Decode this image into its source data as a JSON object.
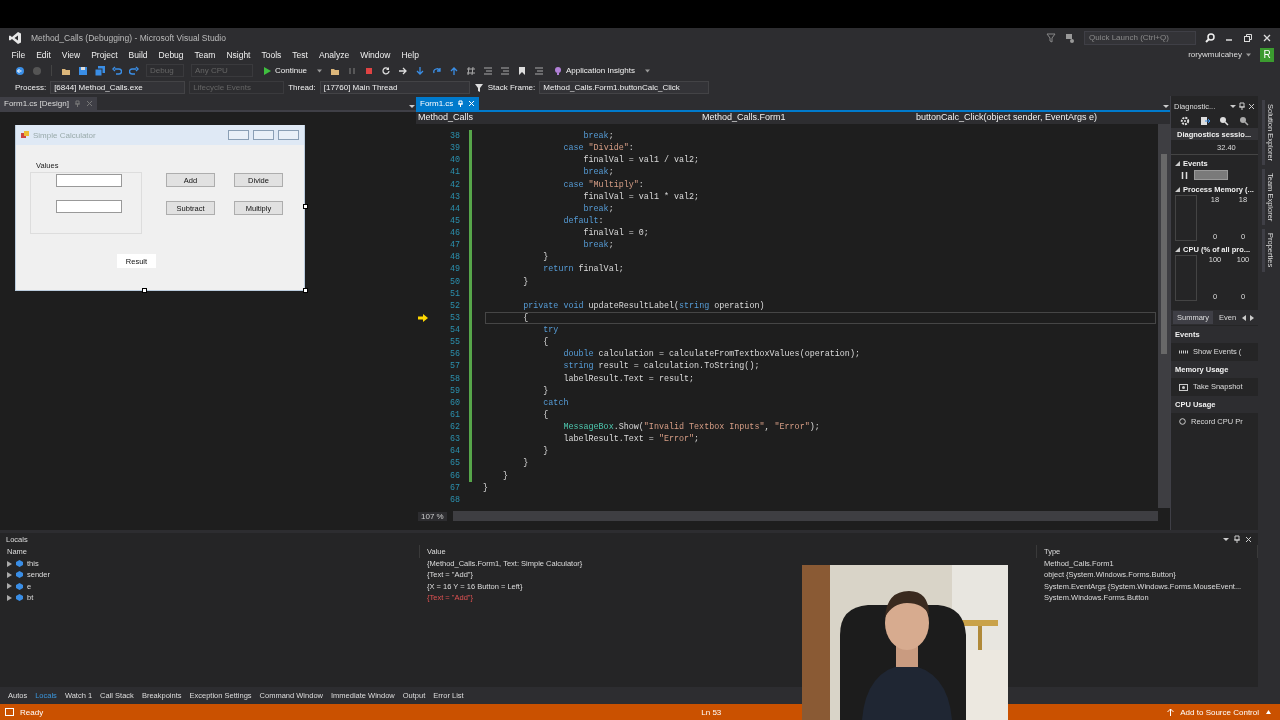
{
  "window": {
    "title": "Method_Calls (Debugging) - Microsoft Visual Studio"
  },
  "title_bar": {
    "quick_launch": {
      "placeholder": "Quick Launch (Ctrl+Q)"
    },
    "user": "rorywmulcahey",
    "avatar": "R"
  },
  "menu": [
    "File",
    "Edit",
    "View",
    "Project",
    "Build",
    "Debug",
    "Team",
    "Nsight",
    "Tools",
    "Test",
    "Analyze",
    "Window",
    "Help"
  ],
  "toolbar": {
    "configuration": {
      "text": "Debug",
      "disabled": true
    },
    "platform": {
      "text": "Any CPU",
      "disabled": true
    },
    "continue": "Continue",
    "application_insights": "Application Insights"
  },
  "debug_location": {
    "process_label": "Process:",
    "process": "[6844] Method_Calls.exe",
    "lifecycle": {
      "text": "Lifecycle Events",
      "disabled": true
    },
    "thread_label": "Thread:",
    "thread": "[17760] Main Thread",
    "stack_frame_label": "Stack Frame:",
    "stack_frame": "Method_Calls.Form1.buttonCalc_Click"
  },
  "designer": {
    "tab": "Form1.cs [Design]",
    "form": {
      "title": "Simple Calculator",
      "group_label": "Values",
      "buttons": [
        "Add",
        "Divide",
        "Subtract",
        "Multiply"
      ],
      "result": "Result"
    }
  },
  "editor": {
    "tab": "Form1.cs",
    "project": "Method_Calls",
    "class": "Method_Calls.Form1",
    "member": "buttonCalc_Click(object sender, EventArgs e)",
    "zoom": "107 %",
    "lines": [
      {
        "number": "38",
        "current": false,
        "tokens": [
          {
            "kind": "keyword",
            "text": "                    break"
          },
          {
            "kind": "plain",
            "text": ";"
          }
        ]
      },
      {
        "number": "39",
        "current": false,
        "tokens": [
          {
            "kind": "keyword",
            "text": "                case"
          },
          {
            "kind": "string",
            "text": " \"Divide\""
          },
          {
            "kind": "plain",
            "text": ":"
          }
        ]
      },
      {
        "number": "40",
        "current": false,
        "tokens": [
          {
            "kind": "plain",
            "text": "                    finalVal = val1 / val2;"
          }
        ]
      },
      {
        "number": "41",
        "current": false,
        "tokens": [
          {
            "kind": "keyword",
            "text": "                    break"
          },
          {
            "kind": "plain",
            "text": ";"
          }
        ]
      },
      {
        "number": "42",
        "current": false,
        "tokens": [
          {
            "kind": "keyword",
            "text": "                case"
          },
          {
            "kind": "string",
            "text": " \"Multiply\""
          },
          {
            "kind": "plain",
            "text": ":"
          }
        ]
      },
      {
        "number": "43",
        "current": false,
        "tokens": [
          {
            "kind": "plain",
            "text": "                    finalVal = val1 * val2;"
          }
        ]
      },
      {
        "number": "44",
        "current": false,
        "tokens": [
          {
            "kind": "keyword",
            "text": "                    break"
          },
          {
            "kind": "plain",
            "text": ";"
          }
        ]
      },
      {
        "number": "45",
        "current": false,
        "tokens": [
          {
            "kind": "keyword",
            "text": "                default"
          },
          {
            "kind": "plain",
            "text": ":"
          }
        ]
      },
      {
        "number": "46",
        "current": false,
        "tokens": [
          {
            "kind": "plain",
            "text": "                    finalVal = 0;"
          }
        ]
      },
      {
        "number": "47",
        "current": false,
        "tokens": [
          {
            "kind": "keyword",
            "text": "                    break"
          },
          {
            "kind": "plain",
            "text": ";"
          }
        ]
      },
      {
        "number": "48",
        "current": false,
        "tokens": [
          {
            "kind": "plain",
            "text": "            }"
          }
        ]
      },
      {
        "number": "49",
        "current": false,
        "tokens": [
          {
            "kind": "keyword",
            "text": "            return"
          },
          {
            "kind": "plain",
            "text": " finalVal;"
          }
        ]
      },
      {
        "number": "50",
        "current": false,
        "tokens": [
          {
            "kind": "plain",
            "text": "        }"
          }
        ]
      },
      {
        "number": "51",
        "current": false
      },
      {
        "number": "52",
        "current": false,
        "tokens": [
          {
            "kind": "keyword",
            "text": "        private void"
          },
          {
            "kind": "plain",
            "text": " updateResultLabel("
          },
          {
            "kind": "keyword",
            "text": "string"
          },
          {
            "kind": "plain",
            "text": " operation)"
          }
        ]
      },
      {
        "number": "53",
        "current": true,
        "tokens": [
          {
            "kind": "plain",
            "text": "        {"
          }
        ]
      },
      {
        "number": "54",
        "current": false,
        "tokens": [
          {
            "kind": "keyword",
            "text": "            try"
          }
        ]
      },
      {
        "number": "55",
        "current": false,
        "tokens": [
          {
            "kind": "plain",
            "text": "            {"
          }
        ]
      },
      {
        "number": "56",
        "current": false,
        "tokens": [
          {
            "kind": "keyword",
            "text": "                double"
          },
          {
            "kind": "plain",
            "text": " calculation = calculateFromTextboxValues(operation);"
          }
        ]
      },
      {
        "number": "57",
        "current": false,
        "tokens": [
          {
            "kind": "keyword",
            "text": "                string"
          },
          {
            "kind": "plain",
            "text": " result = calculation.ToString();"
          }
        ]
      },
      {
        "number": "58",
        "current": false,
        "tokens": [
          {
            "kind": "plain",
            "text": "                labelResult.Text = result;"
          }
        ]
      },
      {
        "number": "59",
        "current": false,
        "tokens": [
          {
            "kind": "plain",
            "text": "            }"
          }
        ]
      },
      {
        "number": "60",
        "current": false,
        "tokens": [
          {
            "kind": "keyword",
            "text": "            catch"
          }
        ]
      },
      {
        "number": "61",
        "current": false,
        "tokens": [
          {
            "kind": "plain",
            "text": "            {"
          }
        ]
      },
      {
        "number": "62",
        "current": false,
        "tokens": [
          {
            "kind": "type",
            "text": "                MessageBox"
          },
          {
            "kind": "plain",
            "text": ".Show("
          },
          {
            "kind": "string",
            "text": "\"Invalid Textbox Inputs\""
          },
          {
            "kind": "plain",
            "text": ", "
          },
          {
            "kind": "string",
            "text": "\"Error\""
          },
          {
            "kind": "plain",
            "text": ");"
          }
        ]
      },
      {
        "number": "63",
        "current": false,
        "tokens": [
          {
            "kind": "plain",
            "text": "                labelResult.Text = "
          },
          {
            "kind": "string",
            "text": "\"Error\""
          },
          {
            "kind": "plain",
            "text": ";"
          }
        ]
      },
      {
        "number": "64",
        "current": false,
        "tokens": [
          {
            "kind": "plain",
            "text": "            }"
          }
        ]
      },
      {
        "number": "65",
        "current": false,
        "tokens": [
          {
            "kind": "plain",
            "text": "        }"
          }
        ]
      },
      {
        "number": "66",
        "current": false,
        "tokens": [
          {
            "kind": "plain",
            "text": "    }"
          }
        ]
      },
      {
        "number": "67",
        "current": false,
        "tokens": [
          {
            "kind": "plain",
            "text": "}"
          }
        ]
      },
      {
        "number": "68",
        "current": false
      }
    ]
  },
  "diagnostics": {
    "title": "Diagnostic...",
    "session": "Diagnostics sessio...",
    "time": "32.40",
    "events": "Events",
    "memory": {
      "title": "Process Memory (...",
      "left_max": "18",
      "right_max": "18",
      "left_min": "0",
      "right_min": "0"
    },
    "cpu": {
      "title": "CPU (% of all pro...",
      "left_max": "100",
      "right_max": "100",
      "left_min": "0",
      "right_min": "0"
    },
    "tabs": [
      {
        "label": "Summary",
        "selected": true
      },
      {
        "label": "Even",
        "selected": false
      }
    ],
    "sections": [
      {
        "heading": "Events",
        "action": "Show Events ("
      },
      {
        "heading": "Memory Usage",
        "action": "Take Snapshot"
      },
      {
        "heading": "CPU Usage",
        "action": "Record CPU Pr"
      }
    ]
  },
  "side_tabs": [
    "Solution Explorer",
    "Team Explorer",
    "Properties"
  ],
  "locals": {
    "title": "Locals",
    "columns": [
      "Name",
      "Value",
      "Type"
    ],
    "rows": [
      {
        "name": "this",
        "value": "{Method_Calls.Form1, Text: Simple Calculator}",
        "type": "Method_Calls.Form1",
        "changed": false
      },
      {
        "name": "sender",
        "value": "{Text = \"Add\"}",
        "type": "object {System.Windows.Forms.Button}",
        "changed": false
      },
      {
        "name": "e",
        "value": "{X = 16 Y = 16 Button = Left}",
        "type": "System.EventArgs {System.Windows.Forms.MouseEvent...",
        "changed": false
      },
      {
        "name": "bt",
        "value": "{Text = \"Add\"}",
        "type": "System.Windows.Forms.Button",
        "changed": true
      }
    ]
  },
  "bottom_tabs": [
    {
      "label": "Autos",
      "selected": false
    },
    {
      "label": "Locals",
      "selected": true
    },
    {
      "label": "Watch 1",
      "selected": false
    },
    {
      "label": "Call Stack",
      "selected": false
    },
    {
      "label": "Breakpoints",
      "selected": false
    },
    {
      "label": "Exception Settings",
      "selected": false
    },
    {
      "label": "Command Window",
      "selected": false
    },
    {
      "label": "Immediate Window",
      "selected": false
    },
    {
      "label": "Output",
      "selected": false
    },
    {
      "label": "Error List",
      "selected": false
    }
  ],
  "status_bar": {
    "state": "Ready",
    "line": "Ln 53",
    "source_control": "Add to Source Control"
  },
  "webcam": {
    "kind": "picture"
  }
}
